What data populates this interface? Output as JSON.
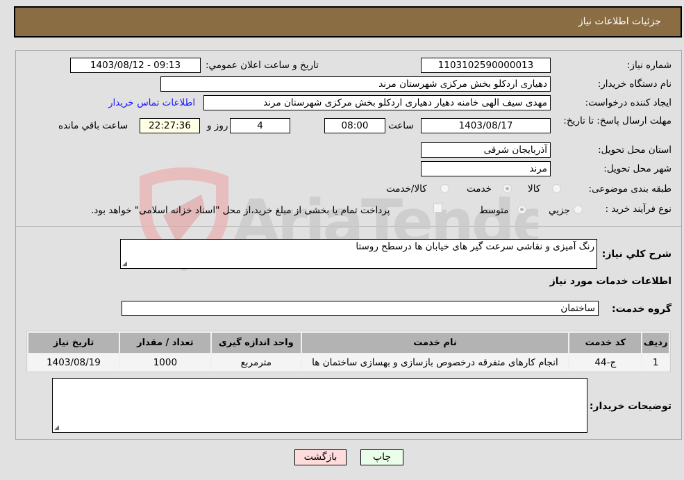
{
  "header": {
    "title": "جزئیات اطلاعات نیاز"
  },
  "form": {
    "need_number": {
      "label": "شماره نیاز:",
      "value": "1103102590000013"
    },
    "announce_datetime": {
      "label": "تاریخ و ساعت اعلان عمومي:",
      "value": "1403/08/12 - 09:13"
    },
    "buyer_org": {
      "label": "نام دستگاه خریدار:",
      "value": "دهیاری اردکلو بخش مرکزی شهرستان مرند"
    },
    "requester": {
      "label": "ایجاد کننده درخواست:",
      "value": "مهدی سیف الهی خامنه دهیار دهیاری اردکلو بخش مرکزی شهرستان مرند"
    },
    "buyer_contact_link": "اطلاعات تماس خریدار",
    "deadline": {
      "label": "مهلت ارسال پاسخ: تا تاریخ:",
      "date": "1403/08/17",
      "time_label": "ساعت",
      "time": "08:00",
      "days": "4",
      "days_label": "روز و",
      "remaining": "22:27:36",
      "remaining_label": "ساعت باقي مانده"
    },
    "province": {
      "label": "استان محل تحویل:",
      "value": "آذربایجان شرقی"
    },
    "city": {
      "label": "شهر محل تحویل:",
      "value": "مرند"
    },
    "category": {
      "label": "طبقه بندی موضوعی:",
      "options": [
        "کالا",
        "خدمت",
        "کالا/خدمت"
      ],
      "selected": "خدمت"
    },
    "purchase_type": {
      "label": "نوع فرآیند خرید :",
      "options": [
        "جزیي",
        "متوسط"
      ],
      "selected": "متوسط",
      "treasury_note": "پرداخت تمام یا بخشی از مبلغ خرید،از محل \"اسناد خزانه اسلامی\" خواهد بود.",
      "treasury_checked": false
    }
  },
  "description": {
    "label": "شرح کلي نیاز:",
    "value": "رنگ آمیزی و نقاشی سرعت گیر های خیابان ها درسطح روستا"
  },
  "services_section": {
    "title": "اطلاعات خدمات مورد نیاز",
    "group_label": "گروه خدمت:",
    "group_value": "ساختمان"
  },
  "services_table": {
    "columns": [
      "ردیف",
      "کد خدمت",
      "نام خدمت",
      "واحد اندازه گیری",
      "تعداد / مقدار",
      "تاریخ نیاز"
    ],
    "rows": [
      [
        "1",
        "ج-44",
        "انجام کارهای متفرقه درخصوص بازسازی و بهسازی ساختمان ها",
        "مترمربع",
        "1000",
        "1403/08/19"
      ]
    ]
  },
  "buyer_notes": {
    "label": "توضیحات خریدار:",
    "value": ""
  },
  "buttons": {
    "print": "چاپ",
    "back": "بازگشت"
  },
  "watermark": {
    "text": "AriaTender.neT"
  },
  "colors": {
    "header_bg": "#8b6d44",
    "print_bg": "#eaffea",
    "back_bg": "#ffdcdc",
    "link": "#1a1aff"
  }
}
